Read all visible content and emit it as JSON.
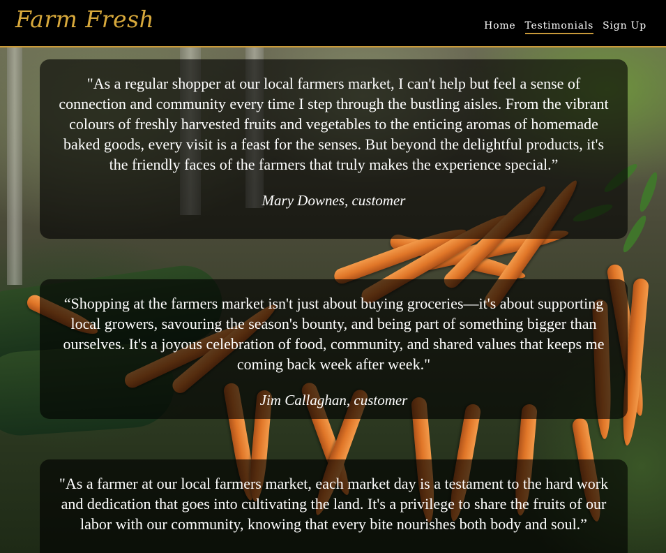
{
  "header": {
    "logo": "Farm Fresh",
    "nav": [
      {
        "label": "Home",
        "active": false
      },
      {
        "label": "Testimonials",
        "active": true
      },
      {
        "label": "Sign Up",
        "active": false
      }
    ]
  },
  "background": {
    "icon": "carrots-photo"
  },
  "testimonials": [
    {
      "quote": "\"As a regular shopper at our local farmers market, I can't help but feel a sense of connection and community every time I step through the bustling aisles. From the vibrant colours of freshly harvested fruits and vegetables to the enticing aromas of homemade baked goods, every visit is a feast for the senses. But beyond the delightful products, it's the friendly faces of the farmers that truly makes the experience special.”",
      "author": "Mary Downes, customer"
    },
    {
      "quote": "“Shopping at the farmers market isn't just about buying groceries—it's about supporting local growers, savouring the season's bounty, and being part of something bigger than ourselves. It's a joyous celebration of food, community, and shared values that keeps me coming back week after week.\"",
      "author": "Jim Callaghan, customer"
    },
    {
      "quote": "\"As a farmer at our local farmers market, each market day is a testament to the hard work and dedication that goes into cultivating the land. It's a privilege to share the fruits of our labor with our community, knowing that every bite nourishes both body and soul.”",
      "author": ""
    }
  ]
}
